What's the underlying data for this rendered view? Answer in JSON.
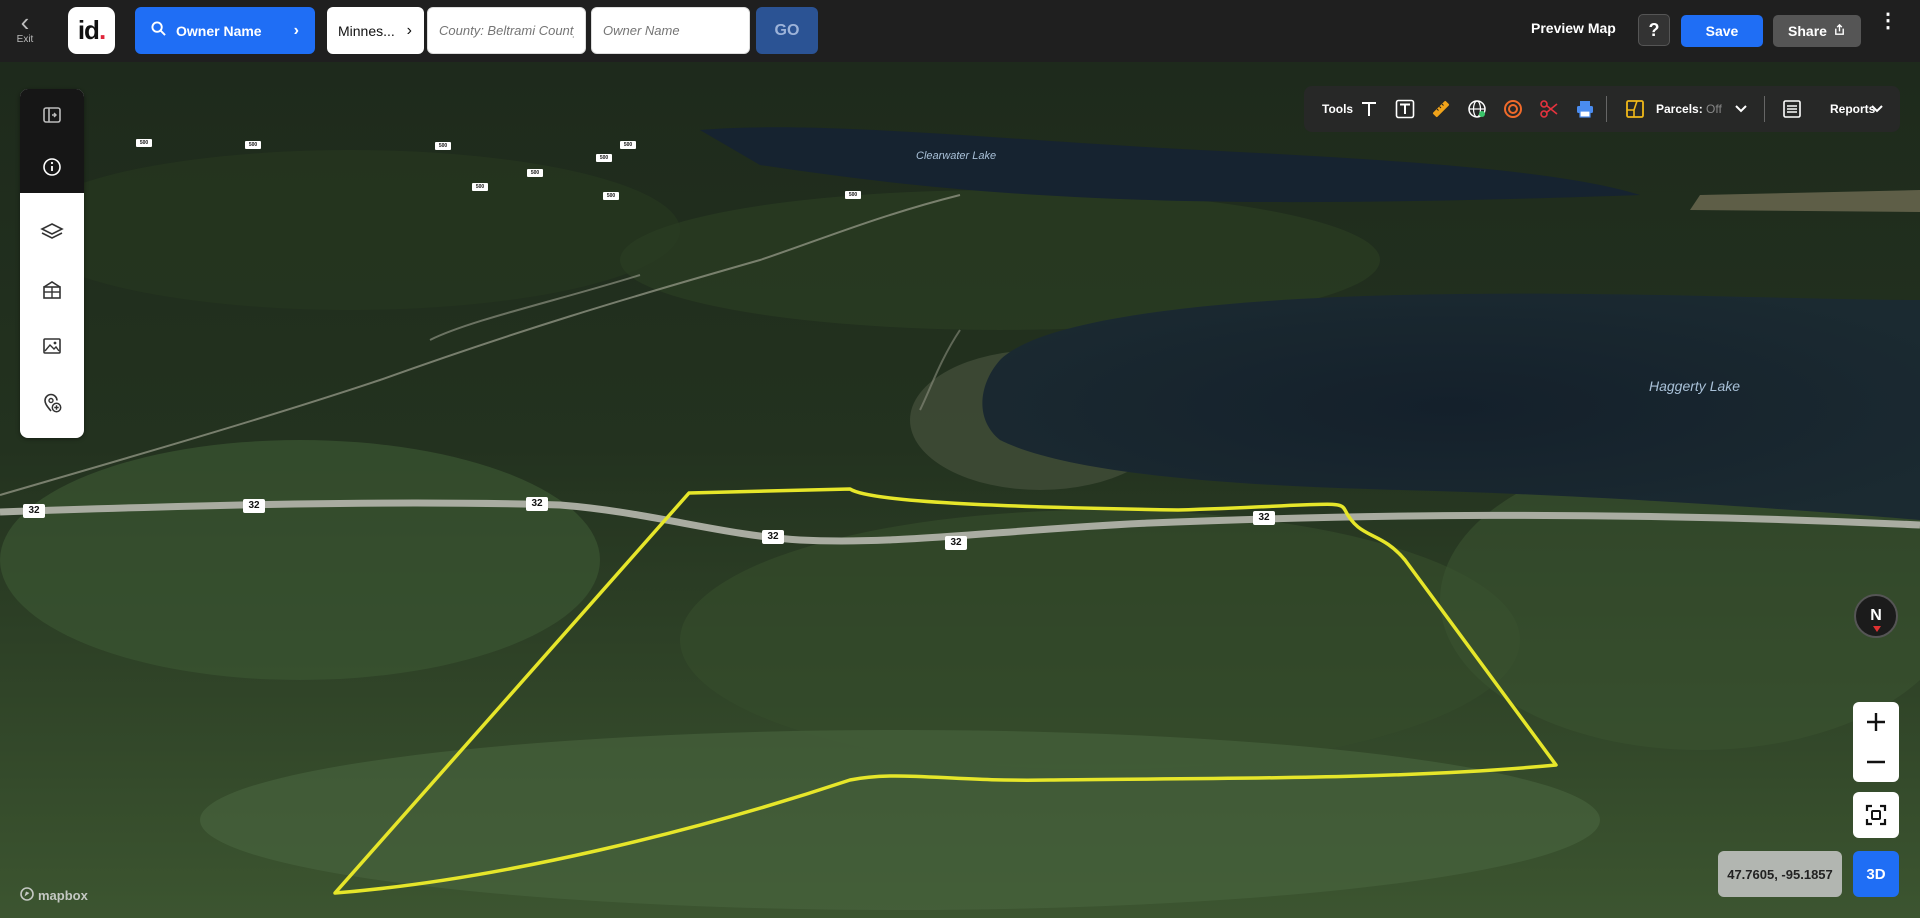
{
  "topbar": {
    "exit_label": "Exit",
    "logo_text": "id",
    "logo_dot": ".",
    "search_type": "Owner Name",
    "state": "Minnes...",
    "county_placeholder": "County: Beltrami County",
    "owner_placeholder": "Owner Name",
    "go_label": "GO",
    "preview_map": "Preview Map",
    "help": "?",
    "save": "Save",
    "share": "Share"
  },
  "left_panel": {
    "icons": [
      "collapse-panel-icon",
      "info-icon",
      "layers-icon",
      "buildings-icon",
      "image-icon",
      "add-location-icon"
    ]
  },
  "tools": {
    "label": "Tools",
    "parcels_label": "Parcels:",
    "parcels_state": "Off",
    "reports_label": "Reports",
    "icons": [
      "text-icon",
      "text-box-icon",
      "ruler-icon",
      "globe-icon",
      "radius-icon",
      "scissors-icon",
      "print-icon",
      "parcels-icon",
      "reports-icon"
    ]
  },
  "map": {
    "labels": {
      "clearwater": "Clearwater Lake",
      "haggerty": "Haggerty Lake"
    },
    "road_shields": [
      "32",
      "32",
      "32",
      "32",
      "32",
      "32",
      "500",
      "500",
      "500",
      "500",
      "500",
      "500",
      "500",
      "500",
      "500"
    ],
    "compass": "N",
    "coordinates": "47.7605, -95.1857",
    "mode_3d": "3D",
    "attribution": "mapbox"
  },
  "colors": {
    "accent_blue": "#1f6ef5",
    "parcel_outline": "#e6e62a"
  }
}
